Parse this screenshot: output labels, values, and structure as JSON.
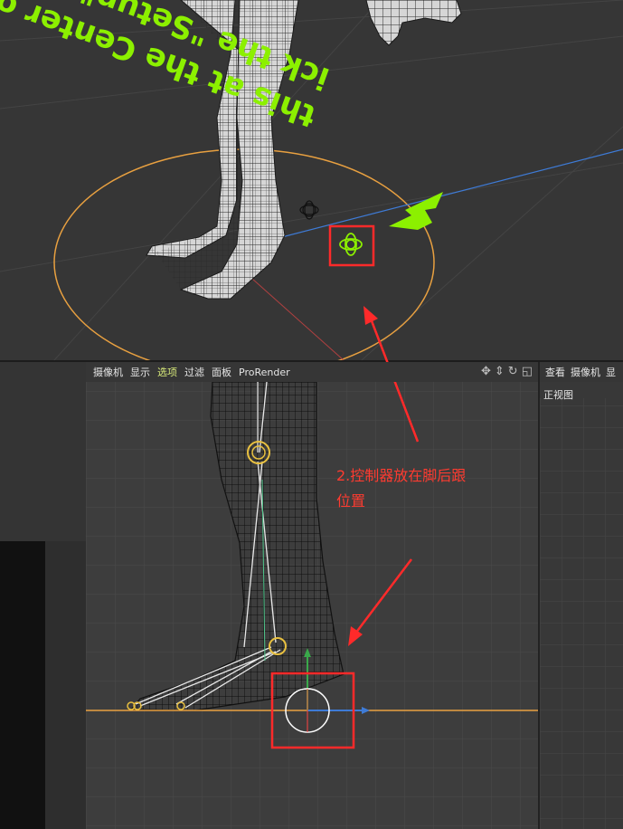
{
  "overlay_text": {
    "line1": "this at the Center o",
    "line2": "ick the \"Setup\" icon"
  },
  "viewport_menu": {
    "items": [
      "摄像机",
      "显示",
      "选项",
      "过滤",
      "面板",
      "ProRender"
    ],
    "active_index": 2
  },
  "right_view": {
    "menu": [
      "查看",
      "摄像机",
      "显"
    ],
    "view_name": "正视图"
  },
  "annotation": {
    "line1": "2.控制器放在脚后跟",
    "line2": "位置"
  },
  "colors": {
    "overlay_green": "#8cf000",
    "annotation_red": "#ff3b30",
    "active_menu": "#d8ea7a",
    "axis_orange": "#e8a040",
    "axis_blue": "#3e7bd6"
  },
  "icons": [
    "move-icon",
    "rotate-icon",
    "refresh-icon",
    "maximize-icon",
    "setup-icon",
    "controller-icon"
  ]
}
